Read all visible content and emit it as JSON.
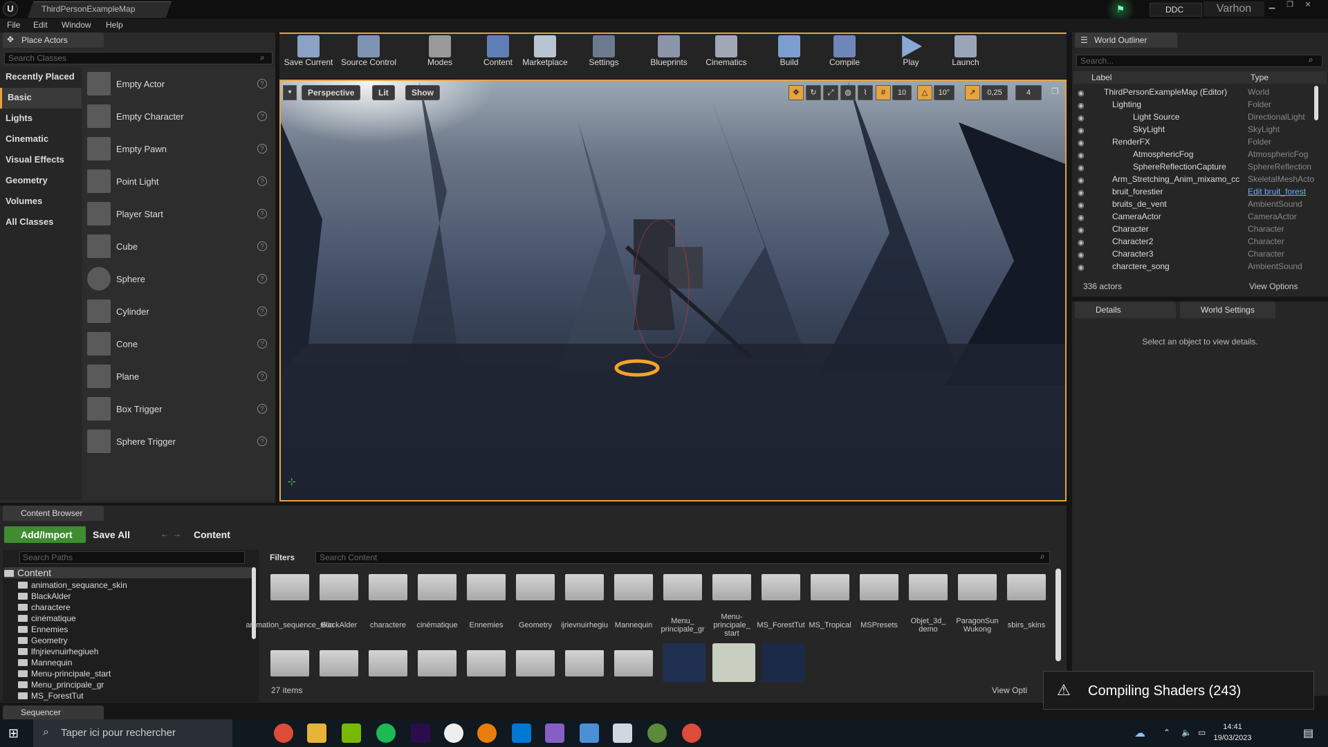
{
  "titlebar": {
    "logo": "U",
    "document": "ThirdPersonExampleMap",
    "ddc": "DDC",
    "user": "Varhon"
  },
  "menu": [
    "File",
    "Edit",
    "Window",
    "Help"
  ],
  "place_actors": {
    "tab": "Place Actors",
    "search_placeholder": "Search Classes",
    "categories": [
      "Recently Placed",
      "Basic",
      "Lights",
      "Cinematic",
      "Visual Effects",
      "Geometry",
      "Volumes",
      "All Classes"
    ],
    "active_category": "Basic",
    "items": [
      "Empty Actor",
      "Empty Character",
      "Empty Pawn",
      "Point Light",
      "Player Start",
      "Cube",
      "Sphere",
      "Cylinder",
      "Cone",
      "Plane",
      "Box Trigger",
      "Sphere Trigger"
    ]
  },
  "toolbar": [
    "Save Current",
    "Source Control",
    "Modes",
    "Content",
    "Marketplace",
    "Settings",
    "Blueprints",
    "Cinematics",
    "Build",
    "Compile",
    "Play",
    "Launch"
  ],
  "viewport": {
    "perspective": "Perspective",
    "lit": "Lit",
    "show": "Show",
    "grid_snap": "10",
    "rot_snap": "10°",
    "scale_snap": "0,25",
    "cam_speed": "4"
  },
  "outliner": {
    "tab": "World Outliner",
    "search_placeholder": "Search...",
    "col_label": "Label",
    "col_type": "Type",
    "rows": [
      {
        "label": "ThirdPersonExampleMap (Editor)",
        "type": "World"
      },
      {
        "label": "Lighting",
        "type": "Folder"
      },
      {
        "label": "Light Source",
        "type": "DirectionalLight"
      },
      {
        "label": "SkyLight",
        "type": "SkyLight"
      },
      {
        "label": "RenderFX",
        "type": "Folder"
      },
      {
        "label": "AtmosphericFog",
        "type": "AtmosphericFog"
      },
      {
        "label": "SphereReflectionCapture",
        "type": "SphereReflection"
      },
      {
        "label": "Arm_Stretching_Anim_mixamo_cc",
        "type": "SkeletalMeshActo"
      },
      {
        "label": "bruit_forestier",
        "type": "Edit bruit_forest"
      },
      {
        "label": "bruits_de_vent",
        "type": "AmbientSound"
      },
      {
        "label": "CameraActor",
        "type": "CameraActor"
      },
      {
        "label": "Character",
        "type": "Character"
      },
      {
        "label": "Character2",
        "type": "Character"
      },
      {
        "label": "Character3",
        "type": "Character"
      },
      {
        "label": "charctere_song",
        "type": "AmbientSound"
      }
    ],
    "count": "336 actors",
    "view_options": "View Options"
  },
  "details": {
    "tab1": "Details",
    "tab2": "World Settings",
    "message": "Select an object to view details."
  },
  "content_browser": {
    "tab": "Content Browser",
    "add_import": "Add/Import",
    "save_all": "Save All",
    "path": "Content",
    "paths_placeholder": "Search Paths",
    "tree": [
      "Content",
      "animation_sequance_skin",
      "BlackAlder",
      "charactere",
      "cinématique",
      "Ennemies",
      "Geometry",
      "lfnjrievnuirhegiueh",
      "Mannequin",
      "Menu-principale_start",
      "Menu_principale_gr",
      "MS_ForestTut"
    ],
    "filters": "Filters",
    "search_placeholder": "Search Content",
    "assets_row1": [
      "animation_sequence_skin",
      "BlackAlder",
      "charactere",
      "cinématique",
      "Ennemies",
      "Geometry",
      "ijrievnuirhegiu",
      "Mannequin",
      "Menu_ principale_gr",
      "Menu- principale_ start",
      "MS_ForestTut",
      "MS_Tropical",
      "MSPresets",
      "Objet_3d_ demo",
      "ParagonSun Wukong",
      "sbirs_skins"
    ],
    "item_count": "27 items",
    "view_options": "View Opti"
  },
  "toast": "Compiling Shaders (243)",
  "sequencer": "Sequencer",
  "taskbar": {
    "search": "Taper ici pour rechercher",
    "time": "14:41",
    "date": "19/03/2023"
  }
}
